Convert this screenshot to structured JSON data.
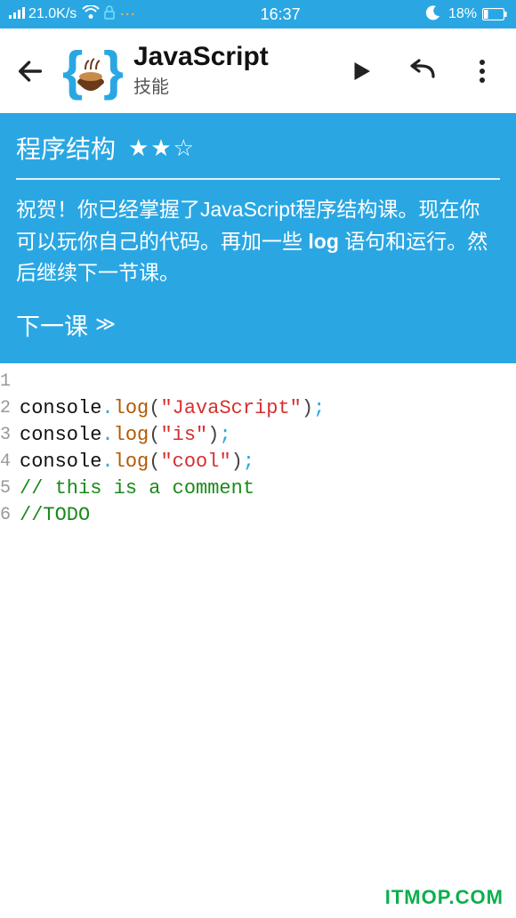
{
  "status_bar": {
    "speed": "21.0K/s",
    "time": "16:37",
    "battery_pct": "18%"
  },
  "app_bar": {
    "title": "JavaScript",
    "subtitle": "技能"
  },
  "lesson": {
    "title": "程序结构",
    "stars": "★★☆",
    "body_pre": "祝贺！你已经掌握了JavaScript程序结构课。现在你可以玩你自己的代码。再加一些 ",
    "body_bold": "log",
    "body_post": " 语句和运行。然后继续下一节课。",
    "next_label": "下一课"
  },
  "code": {
    "lines": [
      {
        "n": "1",
        "tokens": []
      },
      {
        "n": "2",
        "tokens": [
          {
            "t": "obj",
            "v": "console"
          },
          {
            "t": "dot",
            "v": "."
          },
          {
            "t": "fn",
            "v": "log"
          },
          {
            "t": "paren",
            "v": "("
          },
          {
            "t": "str",
            "v": "\"JavaScript\""
          },
          {
            "t": "paren",
            "v": ")"
          },
          {
            "t": "semi",
            "v": ";"
          }
        ]
      },
      {
        "n": "3",
        "tokens": [
          {
            "t": "obj",
            "v": "console"
          },
          {
            "t": "dot",
            "v": "."
          },
          {
            "t": "fn",
            "v": "log"
          },
          {
            "t": "paren",
            "v": "("
          },
          {
            "t": "str",
            "v": "\"is\""
          },
          {
            "t": "paren",
            "v": ")"
          },
          {
            "t": "semi",
            "v": ";"
          }
        ]
      },
      {
        "n": "4",
        "tokens": [
          {
            "t": "obj",
            "v": "console"
          },
          {
            "t": "dot",
            "v": "."
          },
          {
            "t": "fn",
            "v": "log"
          },
          {
            "t": "paren",
            "v": "("
          },
          {
            "t": "str",
            "v": "\"cool\""
          },
          {
            "t": "paren",
            "v": ")"
          },
          {
            "t": "semi",
            "v": ";"
          }
        ]
      },
      {
        "n": "5",
        "tokens": [
          {
            "t": "comment",
            "v": "// this is a comment"
          }
        ]
      },
      {
        "n": "6",
        "tokens": [
          {
            "t": "comment",
            "v": "//TODO"
          }
        ]
      }
    ]
  },
  "watermark": "ITMOP.COM"
}
